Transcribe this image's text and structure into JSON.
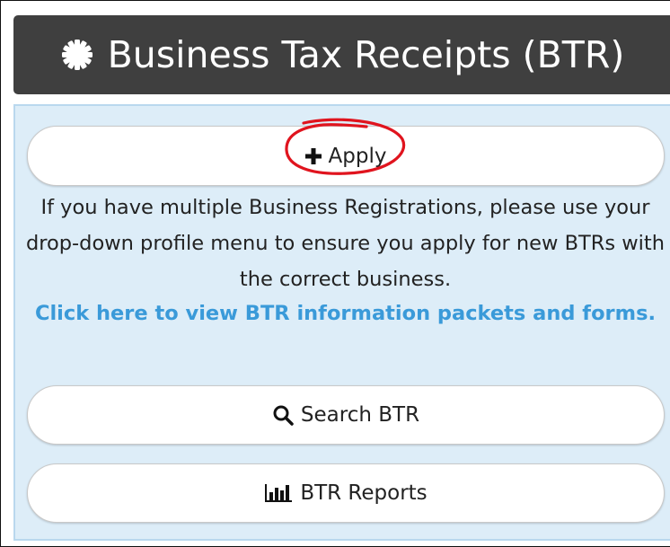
{
  "header": {
    "title": "Business Tax Receipts (BTR)",
    "icon": "gear-icon"
  },
  "actions": {
    "apply_label": "Apply",
    "apply_icon": "plus-icon",
    "search_label": "Search BTR",
    "search_icon": "search-icon",
    "reports_label": "BTR Reports",
    "reports_icon": "bar-chart-icon"
  },
  "info": {
    "message": "If you have multiple Business Registrations, please use your drop-down profile menu to ensure you apply for new BTRs with the correct business.",
    "link_text": "Click here to view BTR information packets and forms."
  },
  "colors": {
    "header_bg": "#3f3f3f",
    "panel_bg": "#ddedf8",
    "link": "#3a9ad9",
    "annotation": "#e0141e"
  }
}
